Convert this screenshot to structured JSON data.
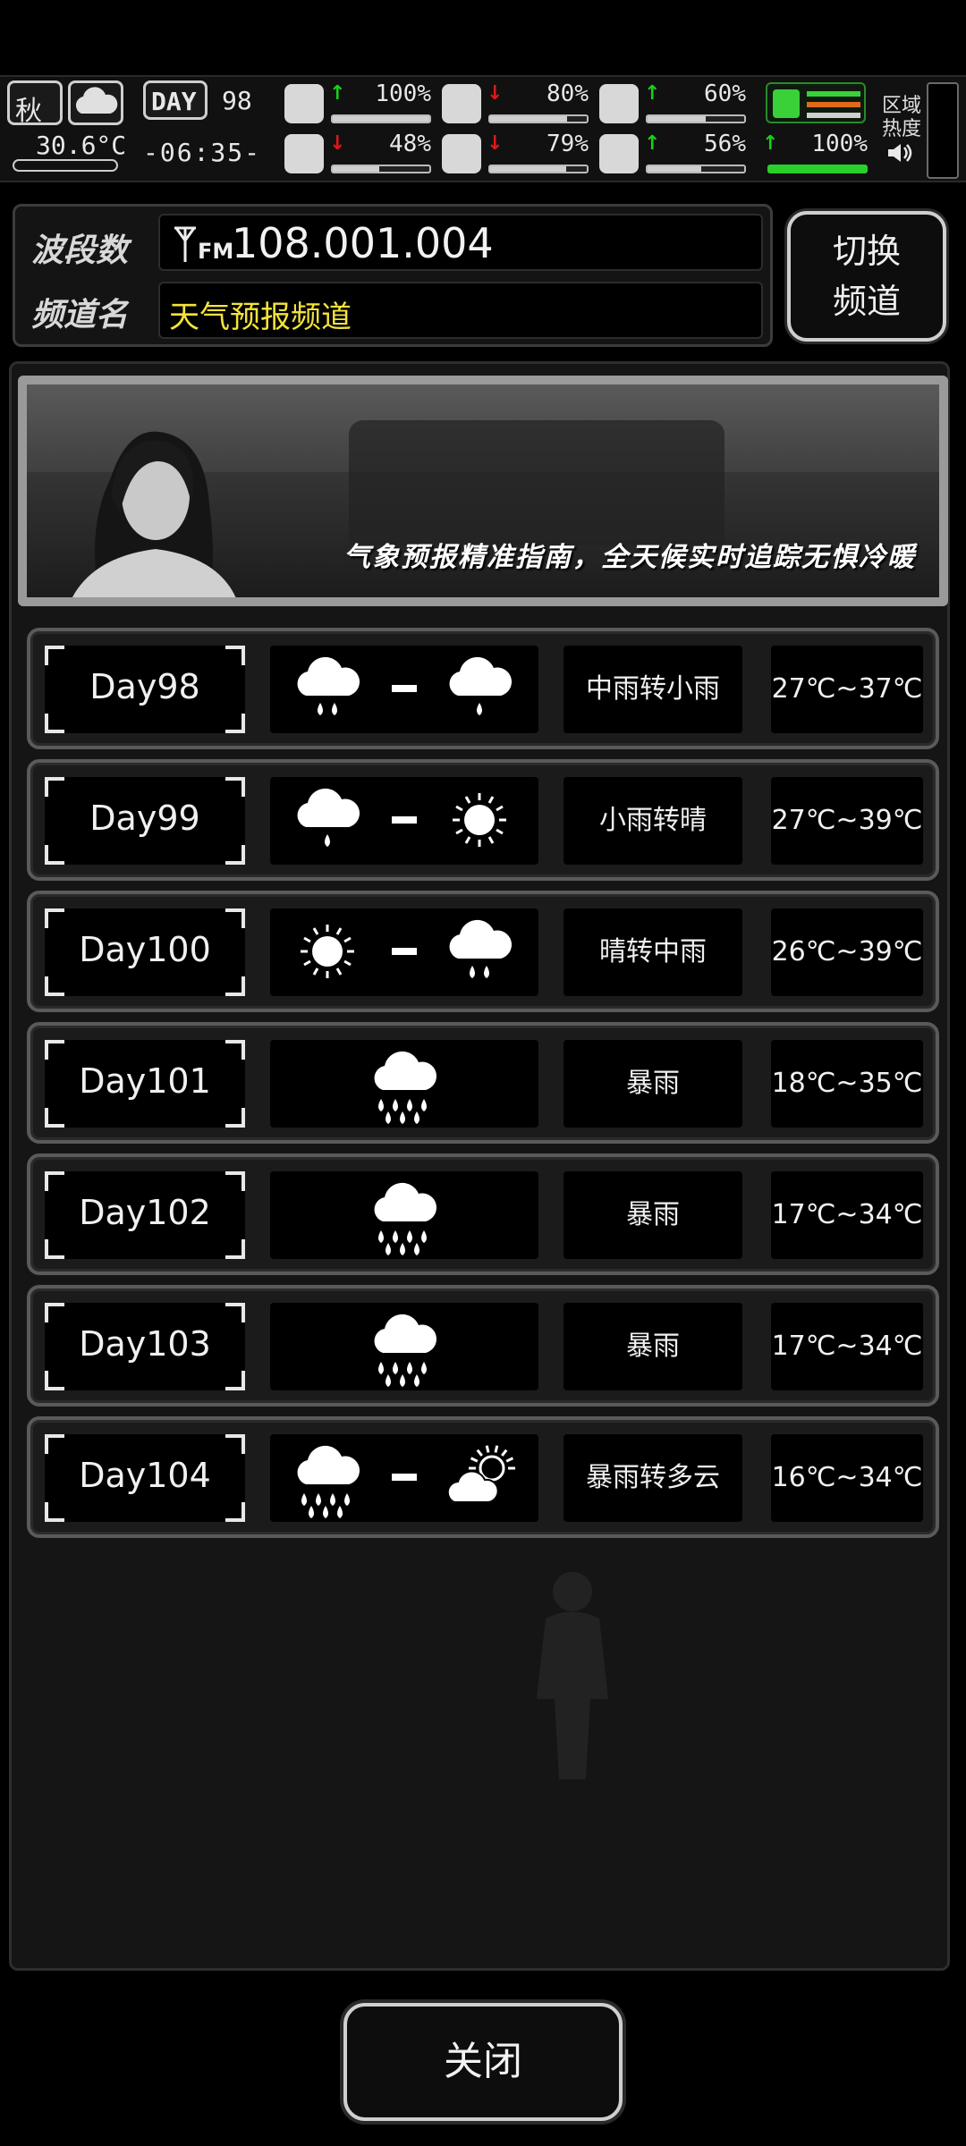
{
  "status": {
    "season": "秋",
    "temperature": "30.6°C",
    "day_label": "DAY",
    "day_number": "98",
    "clock": "-06:35-",
    "region_heat_label_1": "区域",
    "region_heat_label_2": "热度",
    "stats": [
      {
        "icon": "first-aid-icon",
        "trend": "↑",
        "trend_dir": "up",
        "value": "100%",
        "fill": 1.0
      },
      {
        "icon": "stomach-icon",
        "trend": "↓",
        "trend_dir": "down",
        "value": "80%",
        "fill": 0.8
      },
      {
        "icon": "capsule-icon",
        "trend": "↑",
        "trend_dir": "up",
        "value": "60%",
        "fill": 0.6
      },
      {
        "icon": "brain-icon",
        "trend": "↓",
        "trend_dir": "down",
        "value": "48%",
        "fill": 0.48
      },
      {
        "icon": "water-drop-icon",
        "trend": "↓",
        "trend_dir": "down",
        "value": "79%",
        "fill": 0.79
      },
      {
        "icon": "heart-icon",
        "trend": "↑",
        "trend_dir": "up",
        "value": "56%",
        "fill": 0.56
      },
      {
        "icon": "stamina-icon",
        "trend": "↑",
        "trend_dir": "up",
        "value": "100%",
        "fill": 1.0
      }
    ]
  },
  "radio": {
    "band_label": "波段数",
    "band_value": "108.001.004",
    "fm_label": "FM",
    "channel_label": "频道名",
    "channel_value": "天气预报频道",
    "switch_label_1": "切换",
    "switch_label_2": "频道"
  },
  "banner": {
    "text": "气象预报精准指南，全天候实时追踪无惧冷暖"
  },
  "forecast": [
    {
      "day": "Day98",
      "desc": "中雨转小雨",
      "temp": "27℃~37℃",
      "icons": [
        "moderate-rain-icon",
        "light-rain-icon"
      ]
    },
    {
      "day": "Day99",
      "desc": "小雨转晴",
      "temp": "27℃~39℃",
      "icons": [
        "light-rain-icon",
        "sunny-icon"
      ]
    },
    {
      "day": "Day100",
      "desc": "晴转中雨",
      "temp": "26℃~39℃",
      "icons": [
        "sunny-icon",
        "moderate-rain-icon"
      ]
    },
    {
      "day": "Day101",
      "desc": "暴雨",
      "temp": "18℃~35℃",
      "icons": [
        "rainstorm-icon"
      ]
    },
    {
      "day": "Day102",
      "desc": "暴雨",
      "temp": "17℃~34℃",
      "icons": [
        "rainstorm-icon"
      ]
    },
    {
      "day": "Day103",
      "desc": "暴雨",
      "temp": "17℃~34℃",
      "icons": [
        "rainstorm-icon"
      ]
    },
    {
      "day": "Day104",
      "desc": "暴雨转多云",
      "temp": "16℃~34℃",
      "icons": [
        "rainstorm-icon",
        "partly-cloudy-icon"
      ]
    }
  ],
  "close_label": "关闭"
}
